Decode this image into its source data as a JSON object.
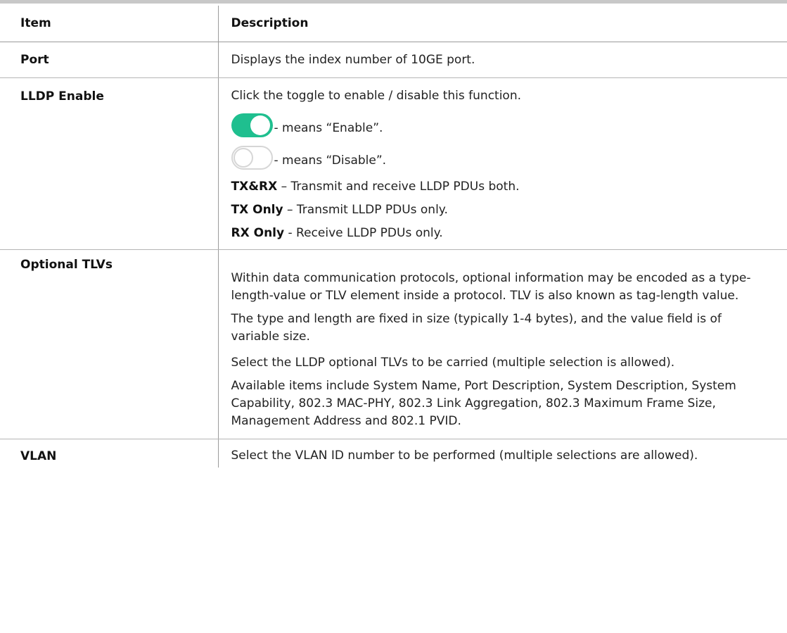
{
  "header": {
    "item": "Item",
    "description": "Description"
  },
  "rows": {
    "port": {
      "item": "Port",
      "desc": "Displays the index number of 10GE port."
    },
    "lldp": {
      "item": "LLDP Enable",
      "intro": "Click the toggle to enable / disable this function.",
      "toggle_on_icon": "toggle-on-icon",
      "toggle_on_text": "- means “Enable”.",
      "toggle_off_icon": "toggle-off-icon",
      "toggle_off_text": "- means “Disable”.",
      "txrx_term": "TX&RX",
      "txrx_text": " – Transmit and receive LLDP PDUs both.",
      "txonly_term": "TX Only",
      "txonly_text": " – Transmit LLDP PDUs only.",
      "rxonly_term": "RX Only",
      "rxonly_text": " - Receive LLDP PDUs only.",
      "colors": {
        "toggle_on": "#1fbf8f",
        "toggle_off_border": "#d6d6d6"
      }
    },
    "tlv": {
      "item": "Optional TLVs",
      "p1": "Within data communication protocols, optional information may be encoded as a type-length-value or TLV element inside a protocol. TLV is also known as tag-length value.",
      "p2": "The type and length are fixed in size (typically 1-4 bytes), and the value field is of variable size.",
      "p3": "Select the LLDP optional TLVs to be carried (multiple selection is allowed).",
      "p4": "Available items include System Name, Port Description, System Description, System Capability, 802.3 MAC-PHY, 802.3 Link Aggregation, 802.3 Maximum Frame Size, Management Address and 802.1 PVID."
    },
    "vlan": {
      "item": "VLAN",
      "desc": "Select the VLAN ID number to be performed (multiple selections are allowed)."
    }
  }
}
